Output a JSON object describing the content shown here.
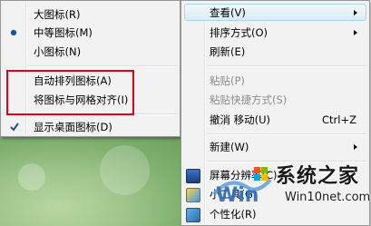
{
  "view_submenu": {
    "items": [
      {
        "label": "大图标(R)"
      },
      {
        "label": "中等图标(M)",
        "selected": true
      },
      {
        "label": "小图标(N)"
      },
      {
        "label": "自动排列图标(A)"
      },
      {
        "label": "将图标与网格对齐(I)"
      },
      {
        "label": "显示桌面图标(D)",
        "checked": true
      }
    ]
  },
  "context_menu": {
    "items": [
      {
        "label": "查看(V)",
        "submenu": true,
        "highlighted": true
      },
      {
        "label": "排序方式(O)",
        "submenu": true
      },
      {
        "label": "刷新(E)"
      },
      {
        "label": "粘贴(P)",
        "disabled": true
      },
      {
        "label": "粘贴快捷方式(S)",
        "disabled": true
      },
      {
        "label": "撤消 移动(U)",
        "shortcut": "Ctrl+Z"
      },
      {
        "label": "新建(W)",
        "submenu": true
      },
      {
        "label": "屏幕分辨率(C)"
      },
      {
        "label": "小工具(G)"
      },
      {
        "label": "个性化(R)"
      }
    ]
  },
  "watermark": {
    "text_cn": "系统之家",
    "url": "Win10net.com"
  },
  "colors": {
    "accent_red": "#e2001a",
    "highlight_border": "#a8d8eb",
    "menu_bg": "#f2f2f2"
  }
}
